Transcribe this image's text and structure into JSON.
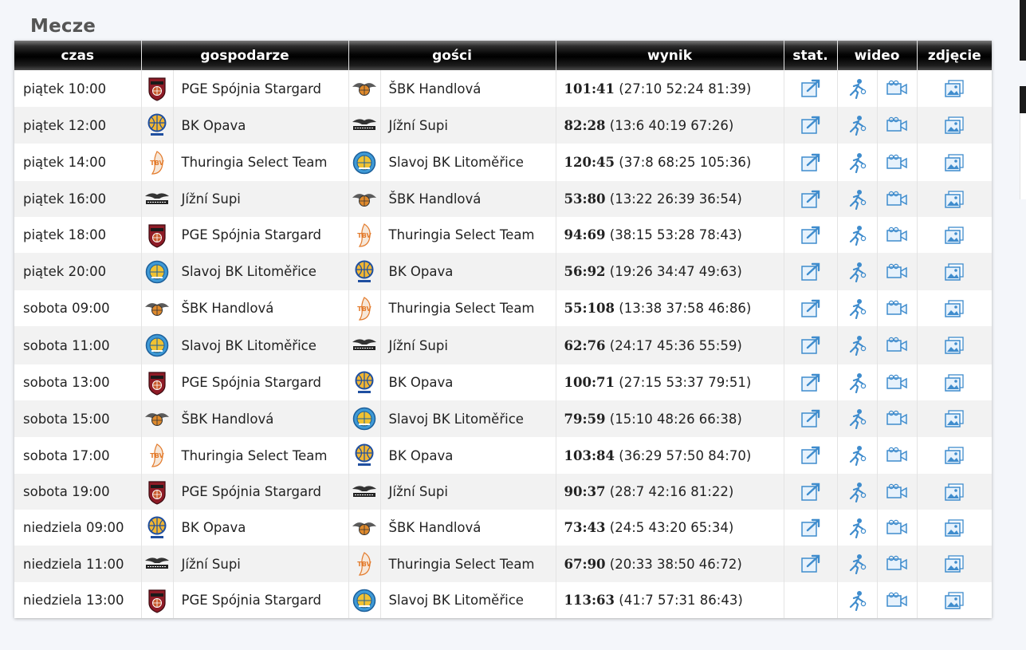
{
  "page": {
    "title": "Mecze"
  },
  "colors": {
    "header_bg": "#000000",
    "icon_blue": "#3f8ccd",
    "logo_red": "#8e1b26"
  },
  "table": {
    "headers": {
      "time": "czas",
      "home": "gospodarze",
      "away": "gości",
      "result": "wynik",
      "stats": "stat.",
      "video": "wideo",
      "photo": "zdjęcie"
    },
    "rows": [
      {
        "time": "piątek 10:00",
        "home": "PGE Spójnia Stargard",
        "home_logo": "spojnia",
        "away": "ŠBK Handlová",
        "away_logo": "handlova",
        "score": "101:41",
        "quarters": "(27:10 52:24 81:39)",
        "stats": true
      },
      {
        "time": "piątek 12:00",
        "home": "BK Opava",
        "home_logo": "opava",
        "away": "Jížní Supi",
        "away_logo": "supi",
        "score": "82:28",
        "quarters": "(13:6 40:19 67:26)",
        "stats": true
      },
      {
        "time": "piątek 14:00",
        "home": "Thuringia Select Team",
        "home_logo": "tbv",
        "away": "Slavoj BK Litoměřice",
        "away_logo": "slavoj",
        "score": "120:45",
        "quarters": "(37:8 68:25 105:36)",
        "stats": true
      },
      {
        "time": "piątek 16:00",
        "home": "Jížní Supi",
        "home_logo": "supi",
        "away": "ŠBK Handlová",
        "away_logo": "handlova",
        "score": "53:80",
        "quarters": "(13:22 26:39 36:54)",
        "stats": true
      },
      {
        "time": "piątek 18:00",
        "home": "PGE Spójnia Stargard",
        "home_logo": "spojnia",
        "away": "Thuringia Select Team",
        "away_logo": "tbv",
        "score": "94:69",
        "quarters": "(38:15 53:28 78:43)",
        "stats": true
      },
      {
        "time": "piątek 20:00",
        "home": "Slavoj BK Litoměřice",
        "home_logo": "slavoj",
        "away": "BK Opava",
        "away_logo": "opava",
        "score": "56:92",
        "quarters": "(19:26 34:47 49:63)",
        "stats": true
      },
      {
        "time": "sobota 09:00",
        "home": "ŠBK Handlová",
        "home_logo": "handlova",
        "away": "Thuringia Select Team",
        "away_logo": "tbv",
        "score": "55:108",
        "quarters": "(13:38 37:58 46:86)",
        "stats": true
      },
      {
        "time": "sobota 11:00",
        "home": "Slavoj BK Litoměřice",
        "home_logo": "slavoj",
        "away": "Jížní Supi",
        "away_logo": "supi",
        "score": "62:76",
        "quarters": "(24:17 45:36 55:59)",
        "stats": true
      },
      {
        "time": "sobota 13:00",
        "home": "PGE Spójnia Stargard",
        "home_logo": "spojnia",
        "away": "BK Opava",
        "away_logo": "opava",
        "score": "100:71",
        "quarters": "(27:15 53:37 79:51)",
        "stats": true
      },
      {
        "time": "sobota 15:00",
        "home": "ŠBK Handlová",
        "home_logo": "handlova",
        "away": "Slavoj BK Litoměřice",
        "away_logo": "slavoj",
        "score": "79:59",
        "quarters": "(15:10 48:26 66:38)",
        "stats": true
      },
      {
        "time": "sobota 17:00",
        "home": "Thuringia Select Team",
        "home_logo": "tbv",
        "away": "BK Opava",
        "away_logo": "opava",
        "score": "103:84",
        "quarters": "(36:29 57:50 84:70)",
        "stats": true
      },
      {
        "time": "sobota 19:00",
        "home": "PGE Spójnia Stargard",
        "home_logo": "spojnia",
        "away": "Jížní Supi",
        "away_logo": "supi",
        "score": "90:37",
        "quarters": "(28:7 42:16 81:22)",
        "stats": true
      },
      {
        "time": "niedziela 09:00",
        "home": "BK Opava",
        "home_logo": "opava",
        "away": "ŠBK Handlová",
        "away_logo": "handlova",
        "score": "73:43",
        "quarters": "(24:5 43:20 65:34)",
        "stats": true
      },
      {
        "time": "niedziela 11:00",
        "home": "Jížní Supi",
        "home_logo": "supi",
        "away": "Thuringia Select Team",
        "away_logo": "tbv",
        "score": "67:90",
        "quarters": "(20:33 38:50 46:72)",
        "stats": true
      },
      {
        "time": "niedziela 13:00",
        "home": "PGE Spójnia Stargard",
        "home_logo": "spojnia",
        "away": "Slavoj BK Litoměřice",
        "away_logo": "slavoj",
        "score": "113:63",
        "quarters": "(41:7 57:31 86:43)",
        "stats": false
      }
    ]
  }
}
